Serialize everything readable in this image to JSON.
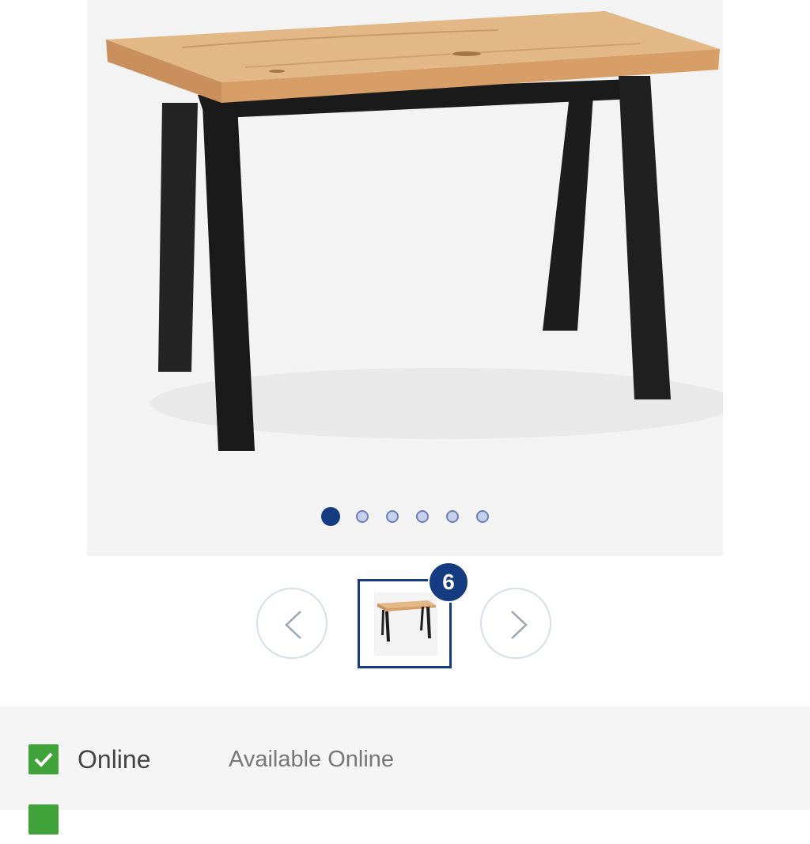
{
  "gallery": {
    "image_name": "desk-with-oak-top-and-black-legs",
    "dot_count": 6,
    "active_dot": 1
  },
  "thumbnails": {
    "image_count": "6"
  },
  "availability": {
    "rows": [
      {
        "label": "Online",
        "value": "Available Online",
        "status": "checked"
      },
      {
        "label": "",
        "value": "",
        "status": "checked"
      }
    ]
  },
  "colors": {
    "brand": "#153b80",
    "check": "#3fa33a",
    "background": "#f3f3f3"
  }
}
